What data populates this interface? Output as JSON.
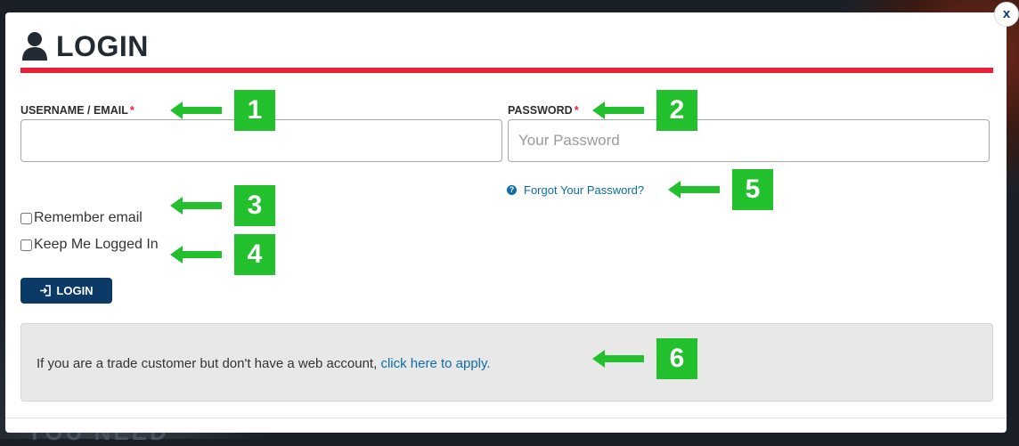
{
  "dialog": {
    "title": "LOGIN",
    "close_label": "x"
  },
  "form": {
    "username_label": "USERNAME / EMAIL",
    "username_required": "*",
    "username_value": "",
    "password_label": "PASSWORD",
    "password_required": "*",
    "password_placeholder": "Your Password",
    "forgot_password": "Forgot Your Password?",
    "remember_email": "Remember email",
    "keep_logged_in": "Keep Me Logged In",
    "login_button": "LOGIN"
  },
  "info": {
    "text": "If you are a trade customer but don't have a web account, ",
    "link": "click here to apply."
  },
  "annotations": [
    "1",
    "2",
    "3",
    "4",
    "5",
    "6"
  ],
  "colors": {
    "accent_red": "#e8203a",
    "primary_navy": "#0b3a66",
    "link_blue": "#0b6ea8",
    "annotation_green": "#22c02c"
  },
  "icons": {
    "title": "user-icon",
    "login_button": "sign-in-icon",
    "forgot": "question-circle-icon",
    "close": "close-icon"
  }
}
